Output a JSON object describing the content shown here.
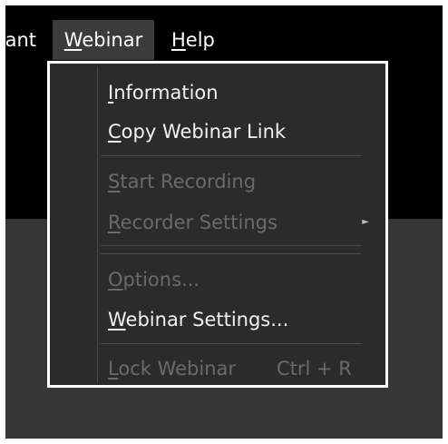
{
  "menubar": {
    "partial_item": {
      "label": "Participant"
    },
    "webinar": {
      "mnemonic": "W",
      "rest": "ebinar"
    },
    "help": {
      "mnemonic": "H",
      "rest": "elp"
    }
  },
  "menu": {
    "information": {
      "mnemonic": "I",
      "rest": "nformation"
    },
    "copy_link": {
      "mnemonic": "C",
      "rest": "opy Webinar Link"
    },
    "start_recording": {
      "mnemonic": "S",
      "rest": "tart Recording",
      "enabled": false
    },
    "recorder_settings": {
      "mnemonic": "R",
      "rest": "ecorder Settings",
      "enabled": false
    },
    "options": {
      "mnemonic": "O",
      "rest": "ptions...",
      "enabled": false
    },
    "webinar_settings": {
      "mnemonic": "W",
      "rest": "ebinar Settings..."
    },
    "lock_webinar": {
      "mnemonic": "L",
      "rest": "ock Webinar",
      "shortcut": "Ctrl + R",
      "enabled": false
    }
  },
  "icons": {
    "submenu": "chevron-right-icon"
  },
  "colors": {
    "menubar_bg": "#000000",
    "menubar_active": "#3b3b3b",
    "menu_bg": "#2b2b2b",
    "menu_border": "#ffffff",
    "text_enabled": "#f2f2f2",
    "text_disabled": "#6a6a6a",
    "lower_area": "#363636"
  }
}
